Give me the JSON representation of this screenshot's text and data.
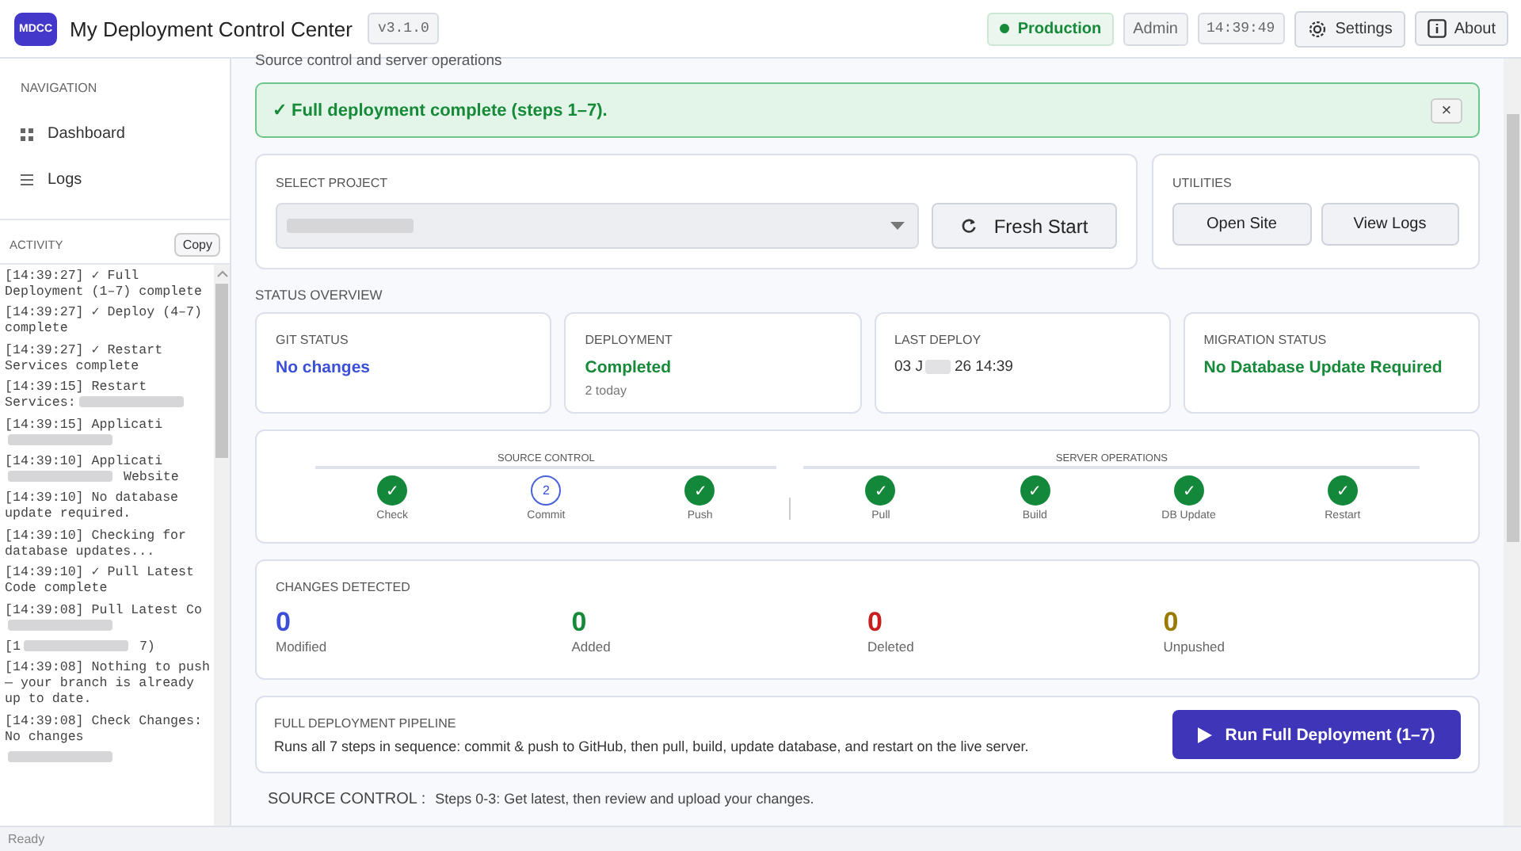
{
  "header": {
    "logo": "MDCC",
    "title": "My Deployment Control Center",
    "version": "v3.1.0",
    "environment": "Production",
    "role": "Admin",
    "time": "14:39:49",
    "settings": "Settings",
    "about": "About"
  },
  "sidebar": {
    "nav_title": "NAVIGATION",
    "items": [
      {
        "label": "Dashboard",
        "selected": false
      },
      {
        "label": "Logs",
        "selected": false
      }
    ],
    "activity_title": "ACTIVITY",
    "copy": "Copy",
    "log": [
      {
        "text": "[14:39:27] ✓ Full Deployment (1–7) complete"
      },
      {
        "text": "[14:39:27] ✓ Deploy (4–7) complete"
      },
      {
        "text": "[14:39:27] ✓ Restart Services complete"
      },
      {
        "text": "[14:39:15] Restart Services:",
        "blurred": true
      },
      {
        "text": "[14:39:15] Applicati",
        "blurred": true
      },
      {
        "text": "[14:39:10] Applicati",
        "blurred": true,
        "tail": "Website"
      },
      {
        "text": "[14:39:10] No database update required."
      },
      {
        "text": "[14:39:10] Checking for database updates..."
      },
      {
        "text": "[14:39:10] ✓ Pull Latest Code complete"
      },
      {
        "text": "[14:39:08] Pull Latest Co",
        "blurred": true
      },
      {
        "text": "[1",
        "blurred": true,
        "tail": "7)"
      },
      {
        "text": "[14:39:08] Nothing to push — your branch is already up to date."
      },
      {
        "text": "[14:39:08] Check Changes: No changes"
      },
      {
        "blurred": true
      }
    ]
  },
  "main": {
    "subtitle": "Source control and server operations",
    "alert": {
      "text": "✓ Full deployment complete (steps 1–7).",
      "close": "×"
    },
    "project": {
      "title": "SELECT PROJECT",
      "value_blurred": true,
      "fresh_start": "Fresh Start"
    },
    "utilities": {
      "title": "UTILITIES",
      "buttons": [
        "Open Site",
        "View Logs"
      ]
    },
    "status_title": "STATUS OVERVIEW",
    "status_cards": [
      {
        "label": "GIT STATUS",
        "value": "No changes",
        "color": "#3b4fd8"
      },
      {
        "label": "DEPLOYMENT",
        "value": "Completed",
        "color": "#178a3a",
        "note": "2 today"
      },
      {
        "label": "LAST DEPLOY",
        "value": "03 J",
        "value_end": "26 14:39",
        "color": "#333333",
        "blurred": true
      },
      {
        "label": "MIGRATION STATUS",
        "value": "No Database Update Required",
        "color": "#178a3a"
      }
    ],
    "step_groups": [
      {
        "title": "SOURCE CONTROL",
        "steps": [
          {
            "label": "Check",
            "done": true,
            "mark": "✓"
          },
          {
            "label": "Commit",
            "done": false,
            "mark": "2"
          },
          {
            "label": "Push",
            "done": true,
            "mark": "✓"
          }
        ]
      },
      {
        "title": "SERVER OPERATIONS",
        "steps": [
          {
            "label": "Pull",
            "done": true,
            "mark": "✓"
          },
          {
            "label": "Build",
            "done": true,
            "mark": "✓"
          },
          {
            "label": "DB Update",
            "done": true,
            "mark": "✓"
          },
          {
            "label": "Restart",
            "done": true,
            "mark": "✓"
          }
        ]
      }
    ],
    "changes": {
      "title": "CHANGES DETECTED",
      "items": [
        {
          "count": "0",
          "label": "Modified",
          "color": "#3b4fd8"
        },
        {
          "count": "0",
          "label": "Added",
          "color": "#178a3a"
        },
        {
          "count": "0",
          "label": "Deleted",
          "color": "#c81e1e"
        },
        {
          "count": "0",
          "label": "Unpushed",
          "color": "#9a7a00"
        }
      ]
    },
    "pipeline": {
      "title": "FULL DEPLOYMENT PIPELINE",
      "description": "Runs all 7 steps in sequence: commit & push to GitHub, then pull, build, update database, and restart on the live server.",
      "button": "Run Full Deployment (1–7)"
    },
    "section": {
      "title": "SOURCE CONTROL :",
      "text": "Steps 0-3: Get latest, then review and upload your changes."
    }
  },
  "status_bar": {
    "text": "Ready"
  }
}
